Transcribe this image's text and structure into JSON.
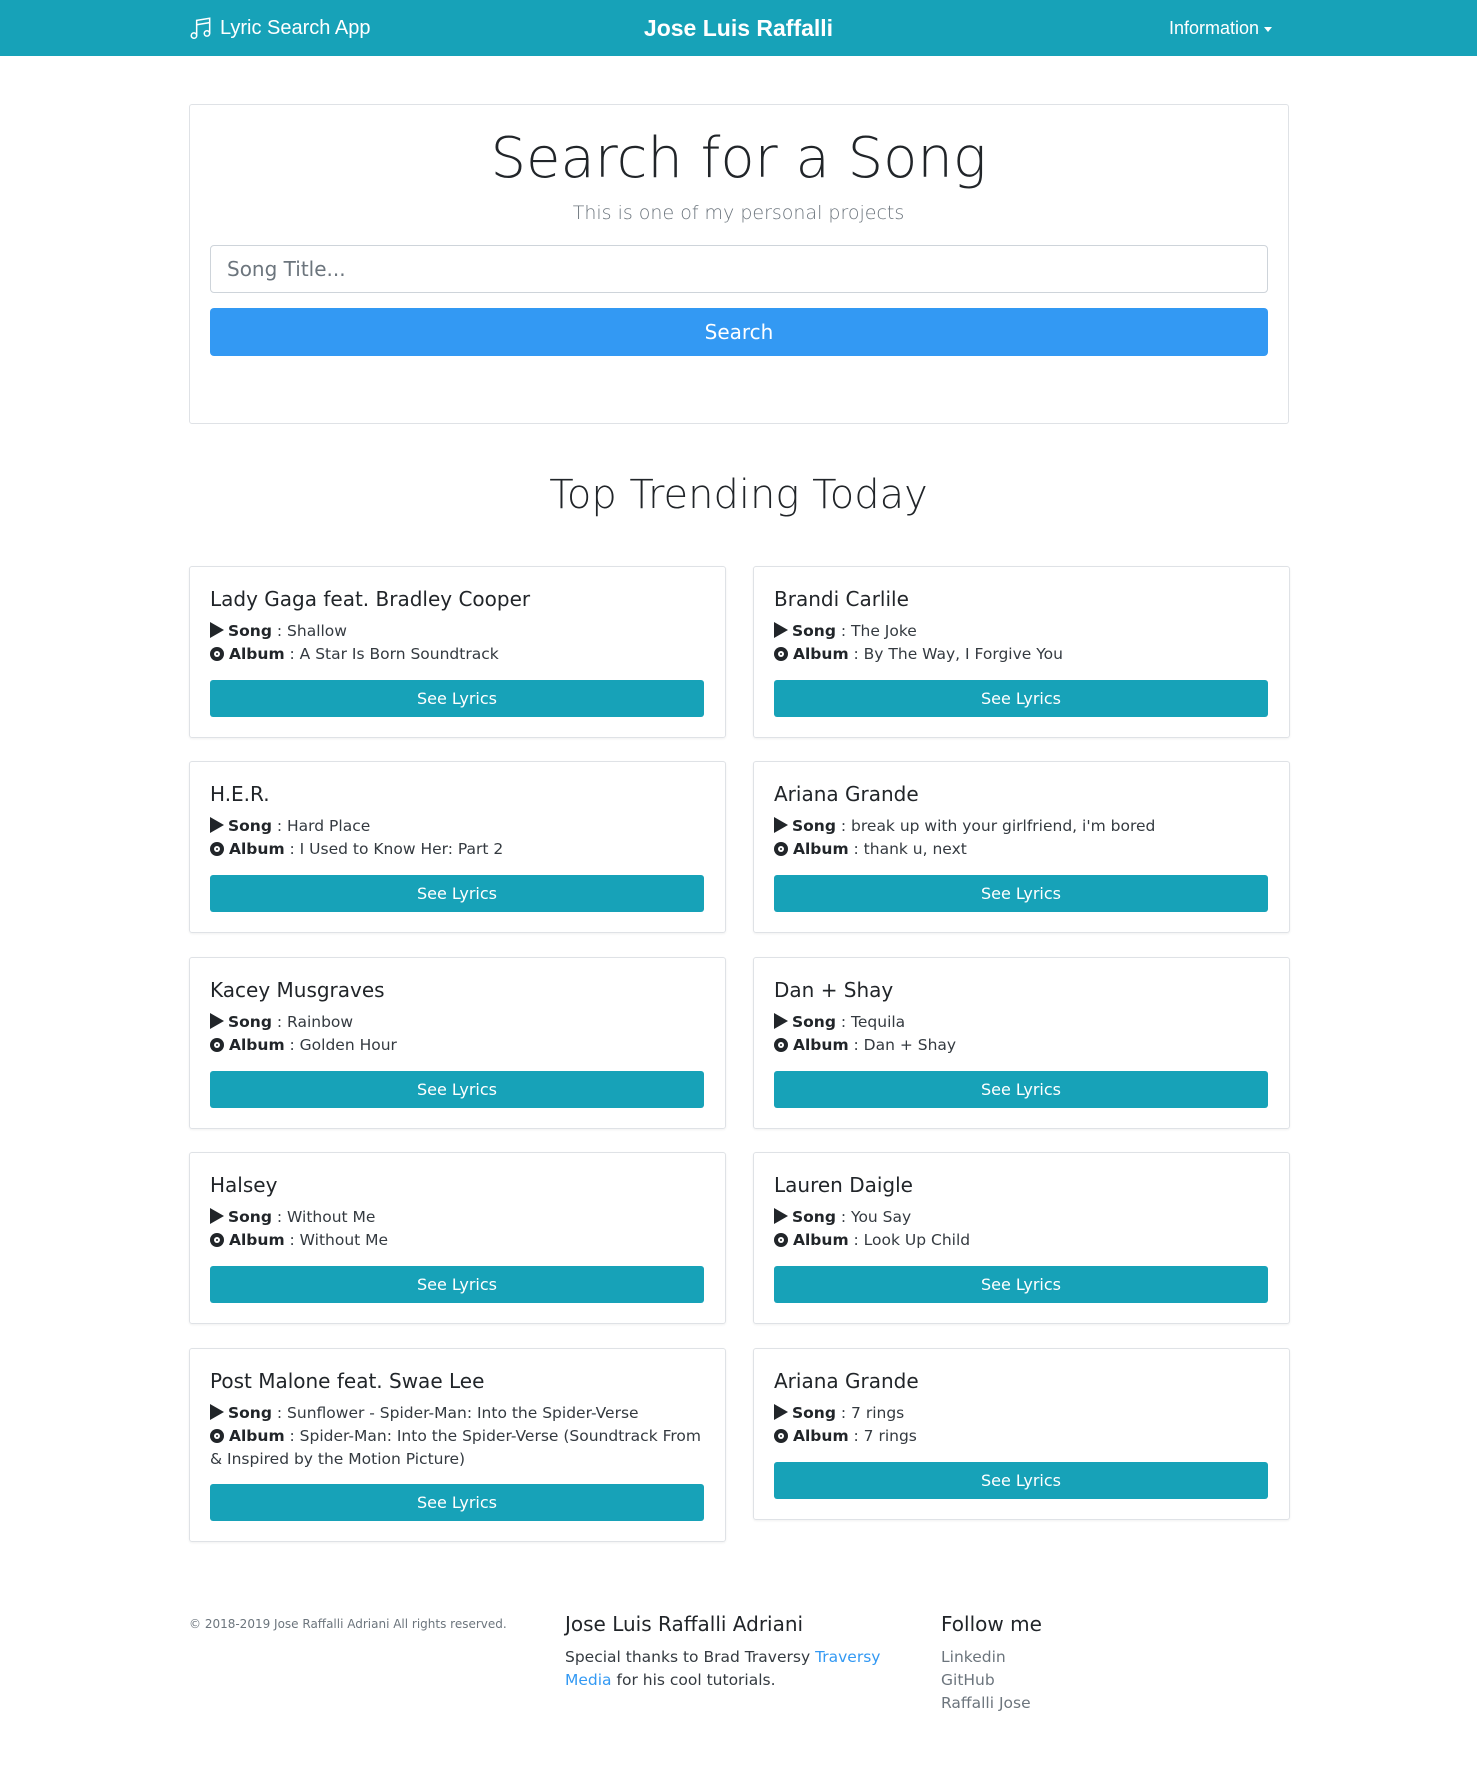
{
  "navbar": {
    "brand": "Lyric Search App",
    "brand_icon": "music-note-icon",
    "center_title": "Jose Luis Raffalli",
    "dropdown_label": "Information",
    "color": "#17a2b8"
  },
  "search": {
    "title": "Search for a Song",
    "subtitle": "This is one of my personal projects",
    "placeholder": "Song Title...",
    "value": "",
    "button_label": "Search",
    "button_color": "#3399f3"
  },
  "trending": {
    "title": "Top Trending Today",
    "song_label": "Song",
    "album_label": "Album",
    "button_label": "See Lyrics",
    "tracks": [
      {
        "artist": "Lady Gaga feat. Bradley Cooper",
        "song": "Shallow",
        "album": "A Star Is Born Soundtrack"
      },
      {
        "artist": "Brandi Carlile",
        "song": "The Joke",
        "album": "By The Way, I Forgive You"
      },
      {
        "artist": "H.E.R.",
        "song": "Hard Place",
        "album": "I Used to Know Her: Part 2"
      },
      {
        "artist": "Ariana Grande",
        "song": "break up with your girlfriend, i'm bored",
        "album": "thank u, next"
      },
      {
        "artist": "Kacey Musgraves",
        "song": "Rainbow",
        "album": "Golden Hour"
      },
      {
        "artist": "Dan + Shay",
        "song": "Tequila",
        "album": "Dan + Shay"
      },
      {
        "artist": "Halsey",
        "song": "Without Me",
        "album": "Without Me"
      },
      {
        "artist": "Lauren Daigle",
        "song": "You Say",
        "album": "Look Up Child"
      },
      {
        "artist": "Post Malone feat. Swae Lee",
        "song": "Sunflower - Spider-Man: Into the Spider-Verse",
        "album": "Spider-Man: Into the Spider-Verse (Soundtrack From & Inspired by the Motion Picture)"
      },
      {
        "artist": "Ariana Grande",
        "song": "7 rings",
        "album": "7 rings"
      }
    ]
  },
  "footer": {
    "copyright": "© 2018-2019 Jose Raffalli Adriani All rights reserved.",
    "name": "Jose Luis Raffalli Adriani",
    "thanks_text": "Special thanks to Brad Traversy",
    "thanks_link": "Traversy Media",
    "thanks_suffix": "for his cool tutorials.",
    "follow_title": "Follow me",
    "links": [
      "Linkedin",
      "GitHub",
      "Raffalli Jose"
    ]
  }
}
